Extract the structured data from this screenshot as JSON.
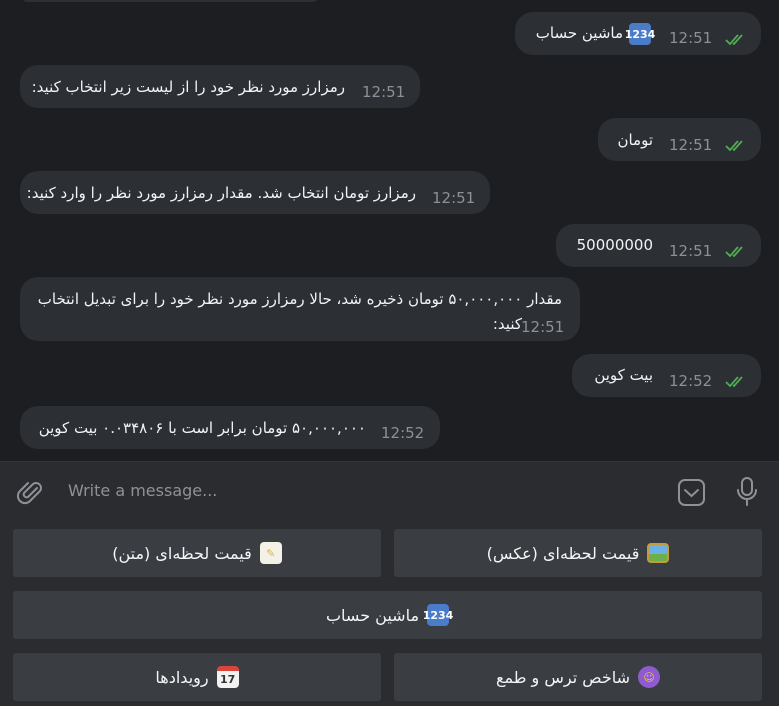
{
  "messages": [
    {
      "dir": "out",
      "text": "ماشین حساب",
      "emoji": "1234",
      "time": "12:51"
    },
    {
      "dir": "in",
      "text": "رمزارز مورد نظر خود را از لیست زیر انتخاب کنید:",
      "time": "12:51"
    },
    {
      "dir": "out",
      "text": "تومان",
      "time": "12:51"
    },
    {
      "dir": "in",
      "text": "رمزارز تومان انتخاب شد. مقدار رمزارز مورد نظر را وارد کنید:",
      "time": "12:51"
    },
    {
      "dir": "out",
      "text": "50000000",
      "time": "12:51"
    },
    {
      "dir": "in",
      "line1": "مقدار ۵۰,۰۰۰,۰۰۰ تومان ذخیره شد، حالا رمزارز مورد نظر خود را برای تبدیل انتخاب",
      "line2": "کنید:",
      "time": "12:51"
    },
    {
      "dir": "out",
      "text": "بیت کوین",
      "time": "12:52"
    },
    {
      "dir": "in",
      "text": "۵۰,۰۰۰,۰۰۰ تومان برابر است با ۰.۰۳۴۸۰۶ بیت کوین",
      "time": "12:52"
    }
  ],
  "composer": {
    "placeholder": "Write a message..."
  },
  "keyboard": {
    "b1": {
      "label": "قیمت لحظه‌ای (متن)",
      "icon": "memo-icon"
    },
    "b2": {
      "label": "قیمت لحظه‌ای (عکس)",
      "icon": "picture-icon"
    },
    "b3": {
      "label": "ماشین حساب",
      "icon": "numbers-icon",
      "glyph": "1234"
    },
    "b4": {
      "label": "رویدادها",
      "icon": "calendar-icon",
      "glyph": "17"
    },
    "b5": {
      "label": "شاخص ترس و طمع",
      "icon": "masks-icon"
    }
  },
  "colors": {
    "bg": "#1d1e21",
    "bubble": "#2c2f33",
    "check": "#4fae4e",
    "key": "#3a3d42"
  }
}
